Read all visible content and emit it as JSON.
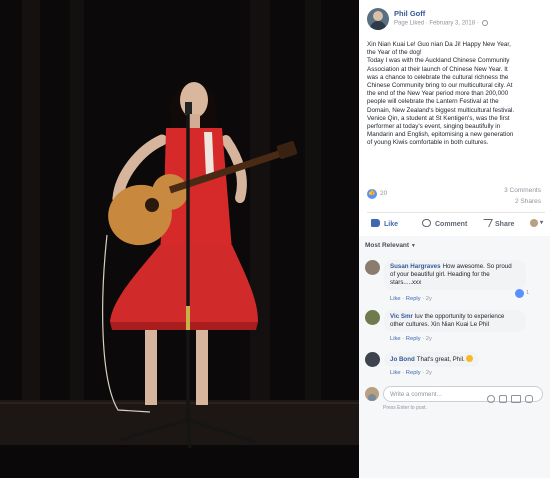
{
  "post": {
    "author": "Phil Goff",
    "meta": "Page Liked · February 3, 2018 · ",
    "body_lines": [
      "Xin Nian Kuai Le! Guo nian Da Ji! Happy New Year,",
      "the Year of the dog!",
      "Today I was with the Auckland Chinese Community",
      "Association at their launch of Chinese New Year. It",
      "was a chance to celebrate the cultural richness the",
      "Chinese Community bring to our multicultural city. At",
      "the end of the New Year period more than 200,000",
      "people will celebrate the Lantern Festival at the",
      "Domain, New Zealand's biggest multicultural festival.",
      "Venice Qin, a student at St Kentigen's, was the first",
      "performer at today's event, singing beautifully in",
      "Mandarin and English, epitomising a new generation",
      "of young Kiwis comfortable in both cultures."
    ]
  },
  "stats": {
    "reactions": "20",
    "comments": "3 Comments",
    "shares": "2 Shares"
  },
  "actions": {
    "like": "Like",
    "comment": "Comment",
    "share": "Share"
  },
  "sort": {
    "label": "Most Relevant"
  },
  "comments": [
    {
      "name": "Susan Hargraves",
      "text_lines": [
        "How awesome. So proud",
        "of your beautiful girl. Heading for the",
        "stars.....xxx"
      ],
      "like_link": "Like",
      "reply_link": "Reply",
      "age": "2y",
      "like_count": "1"
    },
    {
      "name": "Vic Smr",
      "text_lines": [
        "luv the opportunity to experience",
        "other cultures. Xin Nian Kuai Le Phil"
      ],
      "like_link": "Like",
      "reply_link": "Reply",
      "age": "2y"
    },
    {
      "name": "Jo Bond",
      "text_lines": [
        "That's great, Phil."
      ],
      "like_link": "Like",
      "reply_link": "Reply",
      "age": "2y"
    }
  ],
  "composer": {
    "placeholder": "Write a comment...",
    "hint": "Press Enter to post."
  },
  "colors": {
    "link_blue": "#365899",
    "action_blue": "#4267b2",
    "meta_gray": "#90949c",
    "like_badge": "#5890ff",
    "dress_red": "#d62a2a"
  }
}
